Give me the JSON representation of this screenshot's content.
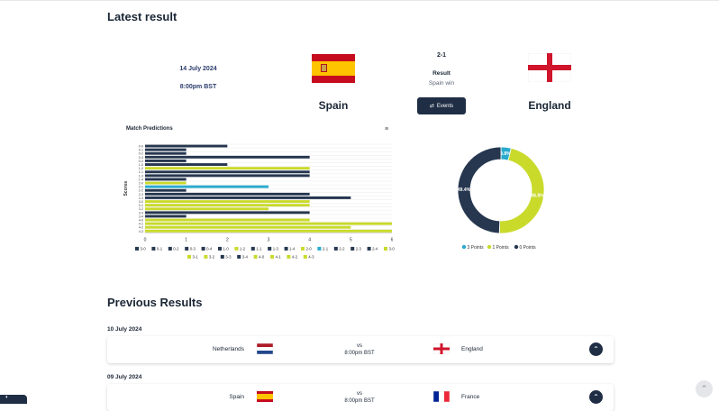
{
  "latest": {
    "heading": "Latest result",
    "date": "14 July 2024",
    "time": "8:00pm BST",
    "home": "Spain",
    "away": "England",
    "score": "2-1",
    "result_label": "Result",
    "result_text": "Spain win",
    "events_label": "Events"
  },
  "chart_title": "Match Predictions",
  "chart_data": [
    {
      "type": "bar",
      "orientation": "horizontal",
      "title": "Match Predictions",
      "ylabel": "Scores",
      "xlim": [
        0,
        6
      ],
      "x_ticks": [
        "0",
        "1",
        "2",
        "3",
        "4",
        "5",
        "6"
      ],
      "categories": [
        "0-0",
        "0-1",
        "0-2",
        "0-3",
        "0-4",
        "1-0",
        "1-2",
        "1-1",
        "1-3",
        "1-4",
        "2-0",
        "2-1",
        "2-2",
        "2-3",
        "2-4",
        "3-0",
        "3-1",
        "3-2",
        "3-3",
        "3-4",
        "4-0",
        "4-1",
        "4-2",
        "4-3"
      ],
      "values": [
        2,
        1,
        1,
        4,
        1,
        2,
        4,
        4,
        4,
        1,
        1,
        3,
        1,
        4,
        5,
        4,
        4,
        3,
        4,
        1,
        4,
        6,
        5,
        6
      ],
      "colors": [
        "#26374f",
        "#26374f",
        "#26374f",
        "#26374f",
        "#26374f",
        "#26374f",
        "#c9da2b",
        "#26374f",
        "#26374f",
        "#26374f",
        "#c9da2b",
        "#28aacd",
        "#26374f",
        "#26374f",
        "#26374f",
        "#c9da2b",
        "#c9da2b",
        "#c9da2b",
        "#26374f",
        "#26374f",
        "#c9da2b",
        "#c9da2b",
        "#c9da2b",
        "#c9da2b"
      ],
      "legend": [
        "3-0",
        "0-1",
        "0-2",
        "0-3",
        "0-4",
        "1-0",
        "1-2",
        "1-1",
        "1-3",
        "1-4",
        "2-0",
        "2-1",
        "2-2",
        "2-3",
        "2-4",
        "3-0",
        "3-1",
        "3-2",
        "3-3",
        "3-4",
        "4-0",
        "4-1",
        "4-2",
        "4-3"
      ],
      "grid": true
    },
    {
      "type": "pie",
      "donut": true,
      "labels": [
        "3 Points",
        "1 Points",
        "0 Points"
      ],
      "values": [
        3.8,
        46.8,
        49.4
      ],
      "display": [
        "3.8%",
        "46.8%",
        "49.4%"
      ],
      "colors": [
        "#28aacd",
        "#c9da2b",
        "#26374f"
      ],
      "legend_position": "bottom"
    }
  ],
  "previous": {
    "heading": "Previous Results",
    "matches": [
      {
        "date": "10 July 2024",
        "home": "Netherlands",
        "vs": "vs",
        "time": "8:00pm BST",
        "away": "England"
      },
      {
        "date": "09 July 2024",
        "home": "Spain",
        "vs": "vs",
        "time": "8:00pm BST",
        "away": "France"
      }
    ]
  },
  "icons": {
    "chevron": "⌃",
    "menu": "≡",
    "scroll_top": "⌃",
    "cookie": "◐",
    "events": "⇄"
  },
  "colors": {
    "navy": "#1f2e45",
    "lime": "#c9da2b",
    "cyan": "#28aacd"
  }
}
